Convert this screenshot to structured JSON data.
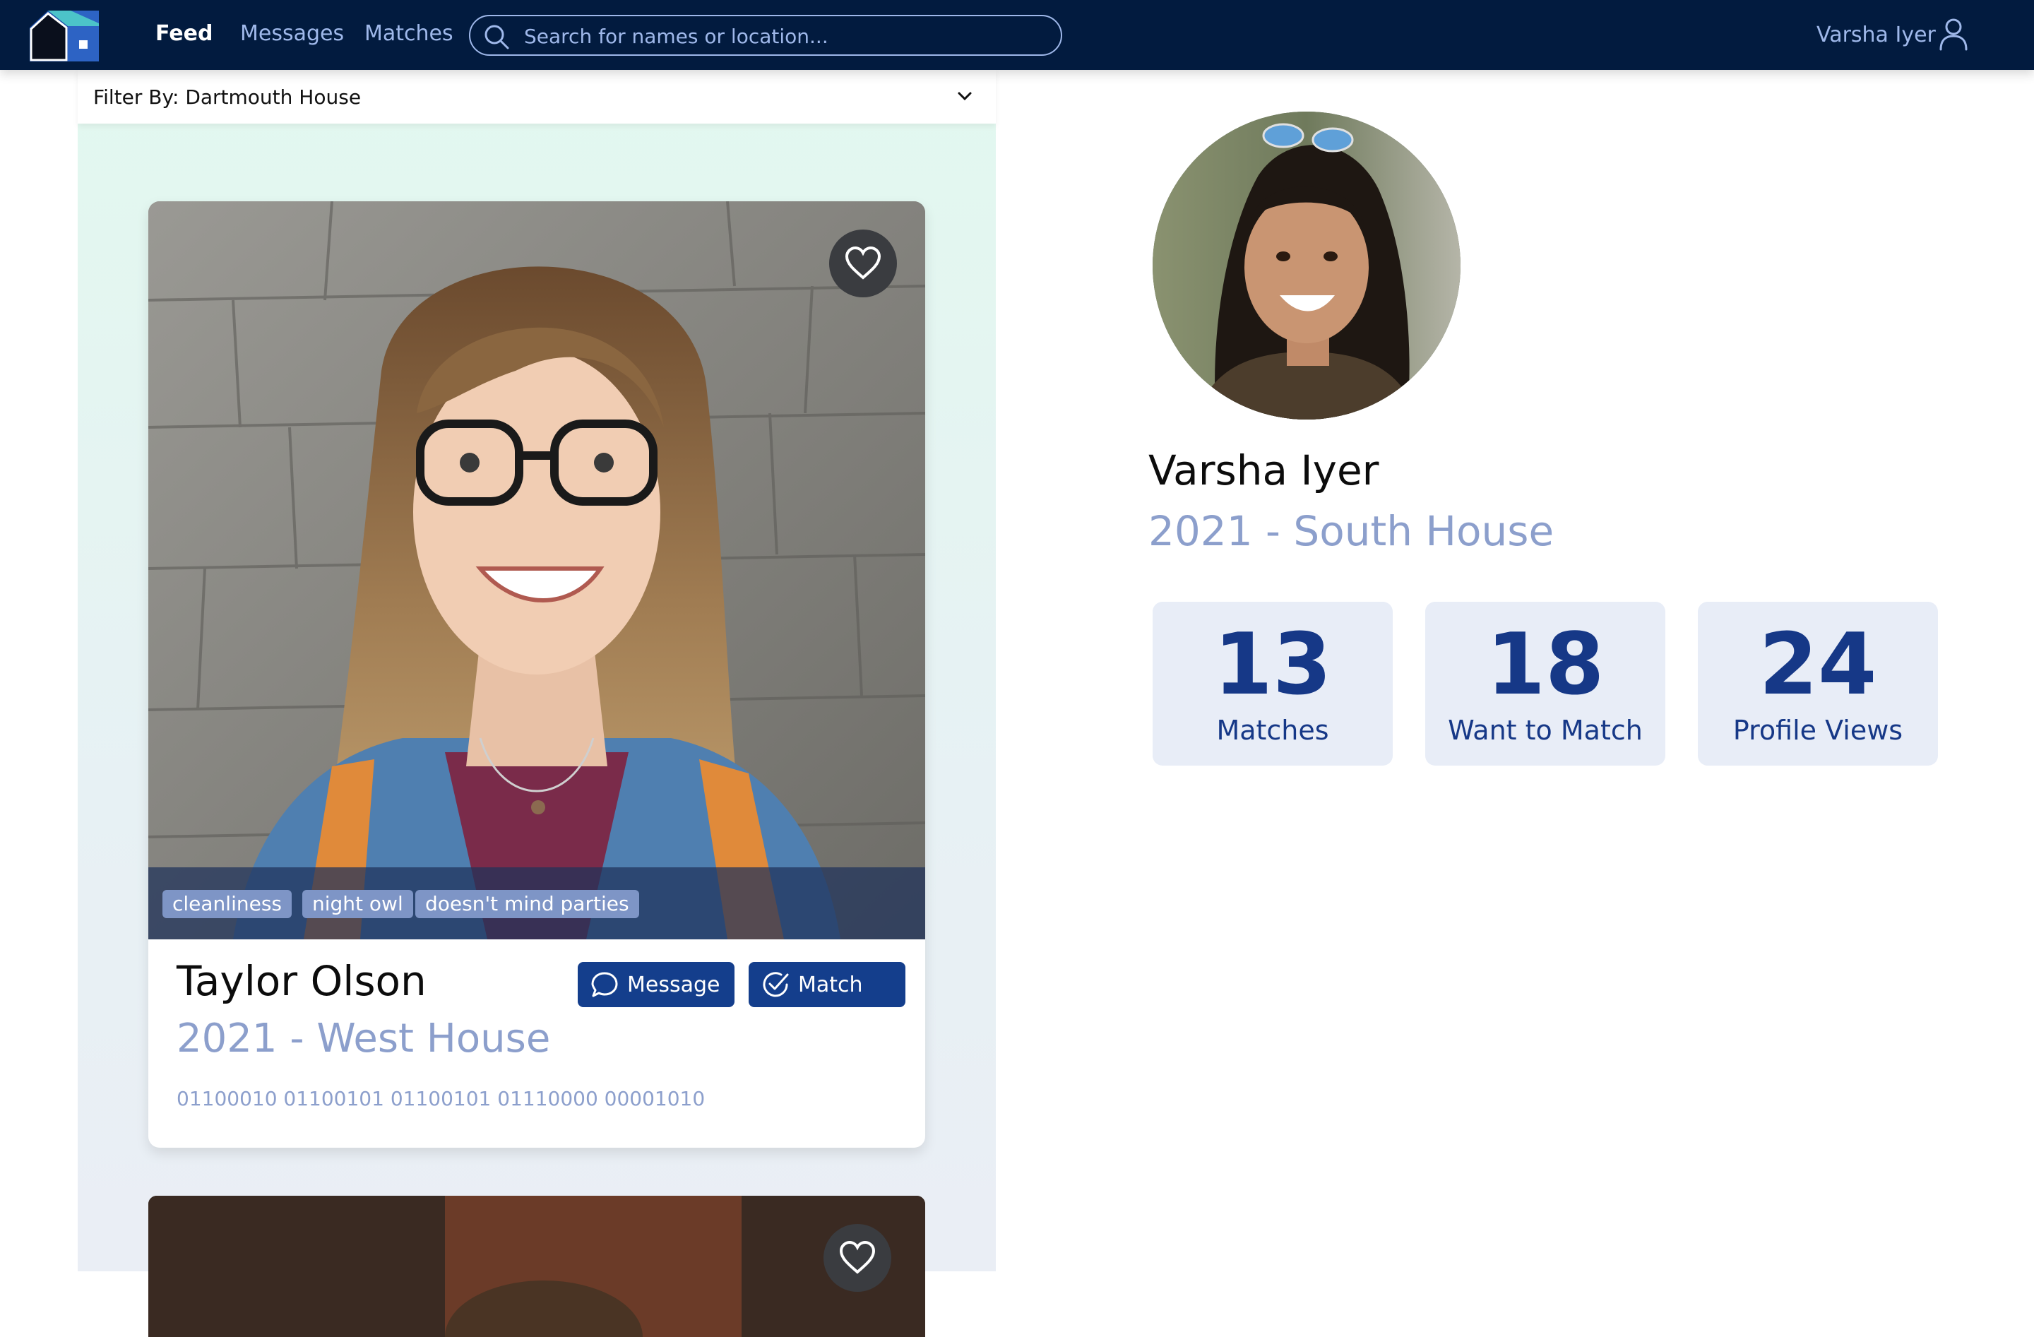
{
  "nav": {
    "links": [
      "Feed",
      "Messages",
      "Matches"
    ],
    "active": "Feed",
    "search_placeholder": "Search for names or location...",
    "user_name": "Varsha Iyer"
  },
  "filter": {
    "label": "Filter By: Dartmouth House"
  },
  "feed": {
    "cards": [
      {
        "name": "Taylor Olson",
        "subtitle": "2021 - West House",
        "tags": [
          "cleanliness",
          "night owl",
          "doesn't mind parties"
        ],
        "binary": "01100010 01100101 01100101 01110000 00001010",
        "message_label": "Message",
        "match_label": "Match"
      }
    ]
  },
  "profile": {
    "name": "Varsha Iyer",
    "subtitle": "2021 - South House",
    "stats": [
      {
        "value": "13",
        "label": "Matches"
      },
      {
        "value": "18",
        "label": "Want to Match"
      },
      {
        "value": "24",
        "label": "Profile Views"
      }
    ]
  },
  "colors": {
    "nav_bg": "#021b3f",
    "accent": "#143e8c",
    "muted": "#8c9fcc",
    "stat_bg": "#e8edf7"
  }
}
